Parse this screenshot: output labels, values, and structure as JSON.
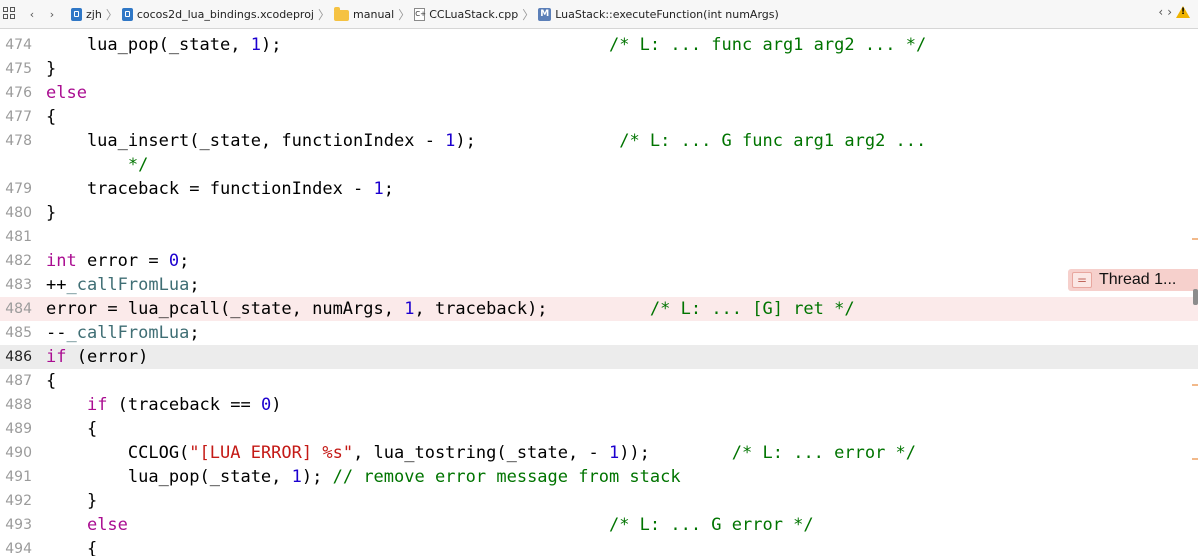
{
  "breadcrumbs": {
    "project": "zjh",
    "xcodeproj": "cocos2d_lua_bindings.xcodeproj",
    "group": "manual",
    "file": "CCLuaStack.cpp",
    "file_icon_glyph": "C+",
    "method_icon_glyph": "M",
    "method": "LuaStack::executeFunction(int numArgs)"
  },
  "lines": [
    {
      "num": "474",
      "tokens": [
        {
          "t": "    lua_pop(_state, ",
          "c": ""
        },
        {
          "t": "1",
          "c": "num"
        },
        {
          "t": ");",
          "c": ""
        },
        {
          "t": "                                ",
          "c": ""
        },
        {
          "t": "/* L: ... func arg1 arg2 ... */",
          "c": "cm"
        }
      ]
    },
    {
      "num": "475",
      "tokens": [
        {
          "t": "}",
          "c": ""
        }
      ]
    },
    {
      "num": "476",
      "tokens": [
        {
          "t": "else",
          "c": "kw"
        }
      ]
    },
    {
      "num": "477",
      "tokens": [
        {
          "t": "{",
          "c": ""
        }
      ]
    },
    {
      "num": "478",
      "tokens": [
        {
          "t": "    lua_insert(_state, functionIndex - ",
          "c": ""
        },
        {
          "t": "1",
          "c": "num"
        },
        {
          "t": ");",
          "c": ""
        },
        {
          "t": "              ",
          "c": ""
        },
        {
          "t": "/* L: ... G func arg1 arg2 ...",
          "c": "cm"
        }
      ]
    },
    {
      "num": "",
      "tokens": [
        {
          "t": "        */",
          "c": "cm"
        }
      ]
    },
    {
      "num": "479",
      "tokens": [
        {
          "t": "    traceback = functionIndex - ",
          "c": ""
        },
        {
          "t": "1",
          "c": "num"
        },
        {
          "t": ";",
          "c": ""
        }
      ]
    },
    {
      "num": "480",
      "tokens": [
        {
          "t": "}",
          "c": ""
        }
      ]
    },
    {
      "num": "481",
      "tokens": []
    },
    {
      "num": "482",
      "tokens": [
        {
          "t": "int",
          "c": "kw"
        },
        {
          "t": " error = ",
          "c": ""
        },
        {
          "t": "0",
          "c": "num"
        },
        {
          "t": ";",
          "c": ""
        }
      ]
    },
    {
      "num": "483",
      "tokens": [
        {
          "t": "++",
          "c": ""
        },
        {
          "t": "_callFromLua",
          "c": "id"
        },
        {
          "t": ";",
          "c": ""
        }
      ]
    },
    {
      "num": "484",
      "tokens": [
        {
          "t": "error = lua_pcall(_state, numArgs, ",
          "c": ""
        },
        {
          "t": "1",
          "c": "num"
        },
        {
          "t": ", traceback);",
          "c": ""
        },
        {
          "t": "          ",
          "c": ""
        },
        {
          "t": "/* L: ... [G] ret */",
          "c": "cm"
        }
      ]
    },
    {
      "num": "485",
      "tokens": [
        {
          "t": "--",
          "c": ""
        },
        {
          "t": "_callFromLua",
          "c": "id"
        },
        {
          "t": ";",
          "c": ""
        }
      ]
    },
    {
      "num": "486",
      "tokens": [
        {
          "t": "if",
          "c": "kw"
        },
        {
          "t": " (error)",
          "c": ""
        }
      ]
    },
    {
      "num": "487",
      "tokens": [
        {
          "t": "{",
          "c": ""
        }
      ]
    },
    {
      "num": "488",
      "tokens": [
        {
          "t": "    ",
          "c": ""
        },
        {
          "t": "if",
          "c": "kw"
        },
        {
          "t": " (traceback == ",
          "c": ""
        },
        {
          "t": "0",
          "c": "num"
        },
        {
          "t": ")",
          "c": ""
        }
      ]
    },
    {
      "num": "489",
      "tokens": [
        {
          "t": "    {",
          "c": ""
        }
      ]
    },
    {
      "num": "490",
      "tokens": [
        {
          "t": "        CCLOG(",
          "c": ""
        },
        {
          "t": "\"[LUA ERROR] %s\"",
          "c": "str"
        },
        {
          "t": ", lua_tostring(_state, - ",
          "c": ""
        },
        {
          "t": "1",
          "c": "num"
        },
        {
          "t": "));",
          "c": ""
        },
        {
          "t": "        ",
          "c": ""
        },
        {
          "t": "/* L: ... error */",
          "c": "cm"
        }
      ]
    },
    {
      "num": "491",
      "tokens": [
        {
          "t": "        lua_pop(_state, ",
          "c": ""
        },
        {
          "t": "1",
          "c": "num"
        },
        {
          "t": "); ",
          "c": ""
        },
        {
          "t": "// remove error message from stack",
          "c": "cm"
        }
      ]
    },
    {
      "num": "492",
      "tokens": [
        {
          "t": "    }",
          "c": ""
        }
      ]
    },
    {
      "num": "493",
      "tokens": [
        {
          "t": "    ",
          "c": ""
        },
        {
          "t": "else",
          "c": "kw"
        },
        {
          "t": "                                               ",
          "c": ""
        },
        {
          "t": "/* L: ... G error */",
          "c": "cm"
        }
      ]
    },
    {
      "num": "494",
      "tokens": [
        {
          "t": "    {",
          "c": ""
        }
      ]
    }
  ],
  "error_badge": {
    "icon_glyph": "=",
    "label": "Thread 1..."
  },
  "colors": {
    "keyword": "#aa0d91",
    "number": "#1c00cf",
    "comment": "#007400",
    "identifier": "#3f6e74",
    "string": "#c41a16",
    "error_line_bg": "#fbeaea",
    "current_line_bg": "#ececec"
  },
  "icons": [
    "grid-icon",
    "back-chevron-icon",
    "forward-chevron-icon",
    "project-icon",
    "xcodeproj-icon",
    "folder-icon",
    "cpp-file-icon",
    "method-icon",
    "issue-prev-icon",
    "issue-next-icon",
    "warning-icon"
  ],
  "highlight": {
    "error_line": "484",
    "current_line": "486"
  }
}
